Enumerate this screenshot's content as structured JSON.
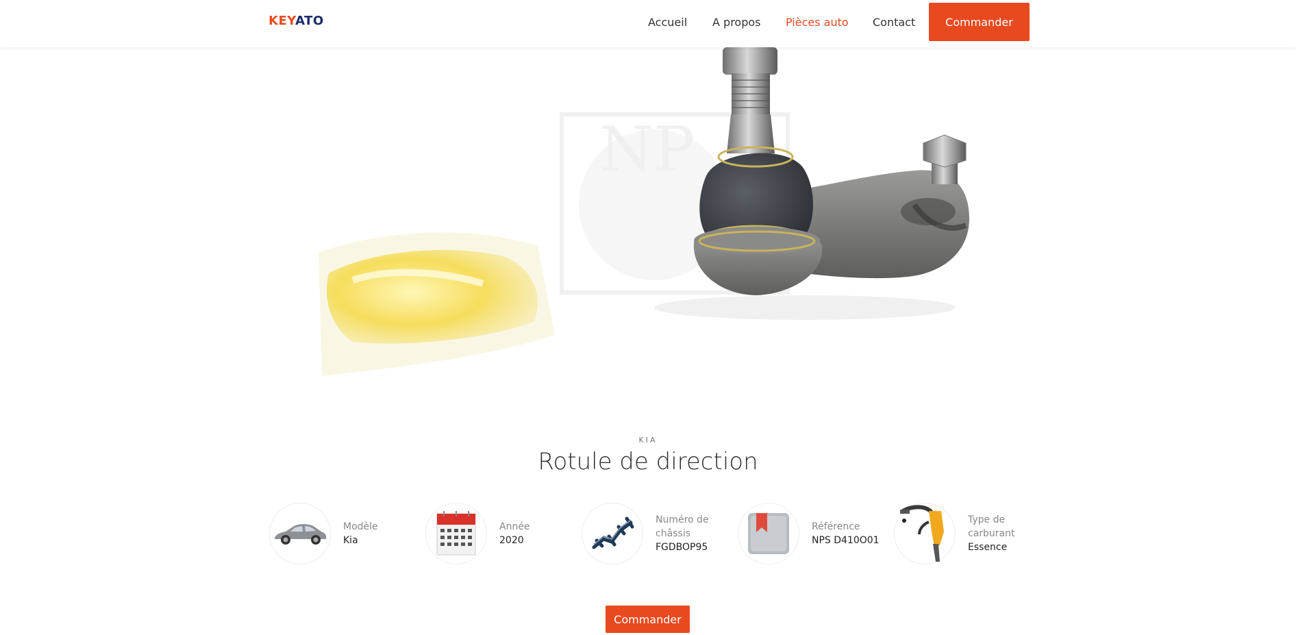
{
  "logo": {
    "part1": "KEY",
    "part2": "ATO"
  },
  "nav": {
    "items": [
      {
        "label": "Accueil"
      },
      {
        "label": "A propos"
      },
      {
        "label": "Pièces auto"
      },
      {
        "label": "Contact"
      }
    ],
    "cta": "Commander"
  },
  "colors": {
    "accent": "#e8491f",
    "logo_dark": "#1b2a6b"
  },
  "product": {
    "brand": "KIA",
    "title": "Rotule de direction",
    "specs": [
      {
        "label": "Modèle",
        "value": "Kia",
        "icon": "car-icon"
      },
      {
        "label": "Année",
        "value": "2020",
        "icon": "calendar-icon"
      },
      {
        "label": "Numéro de châssis",
        "value": "FGDBOP95",
        "icon": "chassis-icon"
      },
      {
        "label": "Référence",
        "value": "NPS D410O01",
        "icon": "bookmark-icon"
      },
      {
        "label": "Type de carburant",
        "value": "Essence",
        "icon": "fuel-pump-icon"
      }
    ],
    "order_button": "Commander"
  },
  "hero": {
    "watermark": "NP"
  }
}
